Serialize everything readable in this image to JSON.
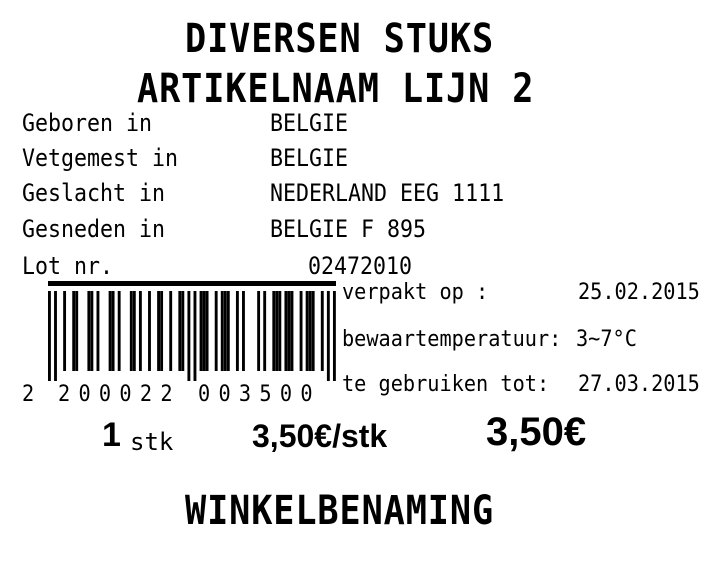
{
  "header": {
    "line1": "DIVERSEN STUKS",
    "line2": "ARTIKELNAAM LIJN 2"
  },
  "origin": {
    "rows": [
      {
        "label": "Geboren in",
        "value": "BELGIE"
      },
      {
        "label": "Vetgemest in",
        "value": "BELGIE"
      },
      {
        "label": "Geslacht in",
        "value": "NEDERLAND EEG 1111"
      },
      {
        "label": "Gesneden in",
        "value": "BELGIE F 895"
      },
      {
        "label": "Lot nr.",
        "value": "02472010"
      }
    ]
  },
  "barcode": {
    "digits": "2 200022 003500",
    "first": "2",
    "group1": "200022",
    "group2": "003500"
  },
  "dates": {
    "packed_label": "verpakt op :",
    "packed_value": "25.02.2015",
    "storage_label": "bewaartemperatuur:",
    "storage_value": "3~7°C",
    "use_by_label": "te gebruiken tot:",
    "use_by_value": "27.03.2015"
  },
  "pricing": {
    "quantity": "1",
    "unit": "stk",
    "unit_price": "3,50€/stk",
    "total": "3,50€"
  },
  "footer": {
    "store_name": "WINKELBENAMING"
  }
}
